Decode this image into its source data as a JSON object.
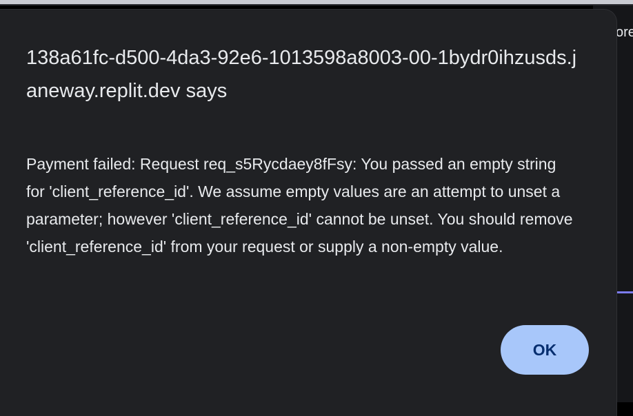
{
  "background": {
    "partial_text": "ore"
  },
  "dialog": {
    "title": "138a61fc-d500-4da3-92e6-1013598a8003-00-1bydr0ihzusds.janeway.replit.dev says",
    "message": "Payment failed: Request req_s5Rycdaey8fFsy: You passed an empty string for 'client_reference_id'. We assume empty values are an attempt to unset a parameter; however 'client_reference_id' cannot be unset. You should remove 'client_reference_id' from your request or supply a non-empty value.",
    "ok_label": "OK"
  },
  "colors": {
    "dialog_background": "#202124",
    "text": "#e8eaed",
    "button_background": "#a8c7fa",
    "button_text": "#062e6f"
  }
}
